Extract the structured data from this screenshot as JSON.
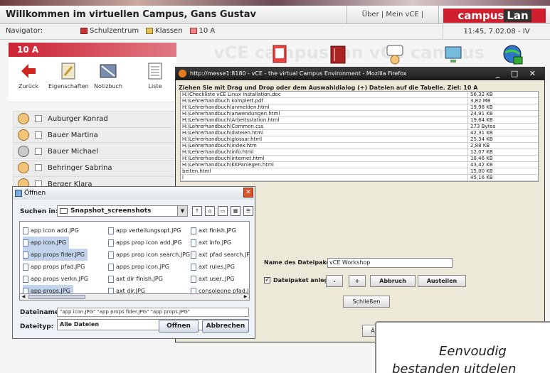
{
  "header": {
    "welcome": "Willkommen im virtuellen Campus, Gans Gustav",
    "links": "Über | Mein vCE | Abmelden",
    "logo_a": "campus",
    "logo_b": "Lan"
  },
  "nav": {
    "label": "Navigator:",
    "crumbs": [
      "Schulzentrum",
      "Klassen",
      "10 A"
    ],
    "time": "11:45, 7.02.08 - IV"
  },
  "classbar": {
    "title": "10 A"
  },
  "toolbar": {
    "items": [
      "Zurück",
      "Eigenschaften",
      "Notizbuch",
      "Liste"
    ]
  },
  "students": [
    "Auburger Konrad",
    "Bauer Martina",
    "Bauer Michael",
    "Behringer Sabrina",
    "Berger Klara"
  ],
  "firefox": {
    "title": "http://messe1:8180 - vCE - the virtual Campus Environment - Mozilla Firefox",
    "hint": "Ziehen Sie mit Drag und Drop oder dem Auswahldialog (+) Dateien auf die Tabelle. Ziel: 10 A",
    "files": [
      {
        "name": "H:\\Checkliste vCE Linux Installation.doc",
        "size": "56,32 KB"
      },
      {
        "name": "H:\\Lehrerhandbuch komplett.pdf",
        "size": "3,82 MB"
      },
      {
        "name": "H:\\Lehrerhandbuch\\anmelden.html",
        "size": "19,98 KB"
      },
      {
        "name": "H:\\Lehrerhandbuch\\anwendungen.html",
        "size": "24,91 KB"
      },
      {
        "name": "H:\\Lehrerhandbuch\\Arbeitsstation.html",
        "size": "19,64 KB"
      },
      {
        "name": "H:\\Lehrerhandbuch\\Common.css",
        "size": "273 Bytes"
      },
      {
        "name": "H:\\Lehrerhandbuch\\dateien.html",
        "size": "42,31 KB"
      },
      {
        "name": "H:\\Lehrerhandbuch\\glossar.html",
        "size": "25,34 KB"
      },
      {
        "name": "H:\\Lehrerhandbuch\\index.htm",
        "size": "2,88 KB"
      },
      {
        "name": "H:\\Lehrerhandbuch\\info.html",
        "size": "12,07 KB"
      },
      {
        "name": "H:\\Lehrerhandbuch\\internet.html",
        "size": "18,46 KB"
      },
      {
        "name": "H:\\Lehrerhandbuch\\KKPanlegen.html",
        "size": "43,42 KB"
      },
      {
        "name": "beiten.html",
        "size": "15,00 KB"
      },
      {
        "name": "l",
        "size": "45,16 KB"
      }
    ],
    "package_label": "Name des Dateipaketes",
    "package_value": "vCE Workshop",
    "create_label": "Dateipaket anlegen",
    "minus": "-",
    "plus": "+",
    "cancel": "Abbruch",
    "share": "Austeilen",
    "close": "Schließen",
    "footer_btn": "Änd"
  },
  "open_dialog": {
    "title": "Öffnen",
    "lookin_label": "Suchen in:",
    "lookin_value": "Snapshot_screenshots",
    "files": [
      "app icon add.JPG",
      "app icon.JPG",
      "app props fider.JPG",
      "app props pfad.JPG",
      "app props verkn.JPG",
      "app props.JPG",
      "app verteilungsopt.JPG",
      "apps prop icon add.JPG",
      "apps prop icon search.JPG",
      "apps prop icon.JPG",
      "axt dir finish.JPG",
      "axt dir.JPG",
      "axt finish.JPG",
      "axt info.JPG",
      "axt pfad search.JPG",
      "axt rules.JPG",
      "axt user..JPG",
      "consoleone pfad.JPG"
    ],
    "filename_label": "Dateiname:",
    "filename_value": "\"app icon.JPG\" \"app props fider.JPG\" \"app props.JPG\"",
    "filetype_label": "Dateityp:",
    "filetype_value": "Alle Dateien",
    "open": "Offnen",
    "cancel": "Abbrechen"
  },
  "callout": {
    "line1": "Eenvoudig",
    "line2": "bestanden uitdelen"
  }
}
